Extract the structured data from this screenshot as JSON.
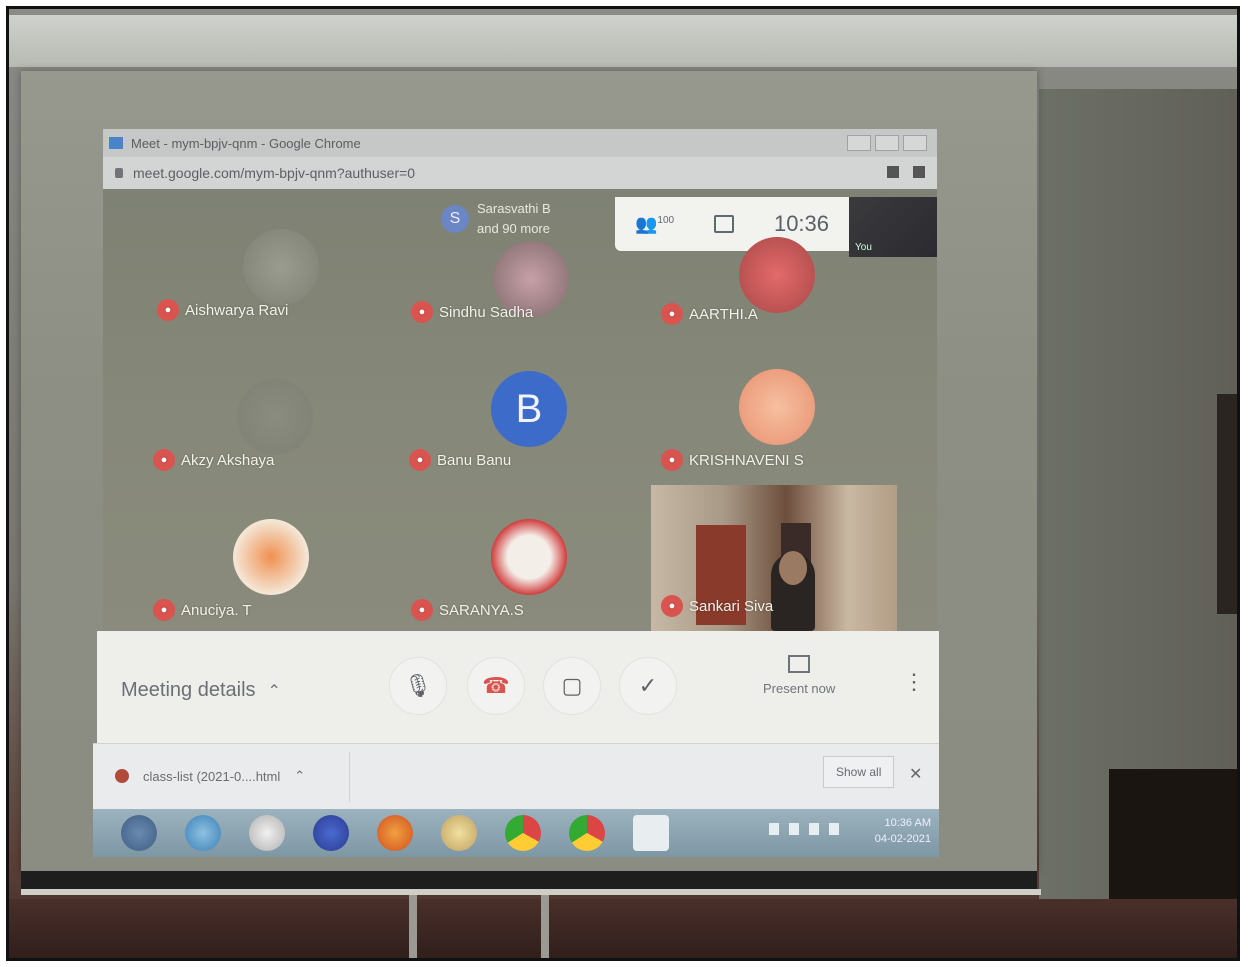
{
  "browser": {
    "title": "Meet - mym-bpjv-qnm - Google Chrome",
    "url": "meet.google.com/mym-bpjv-qnm?authuser=0"
  },
  "meet": {
    "presenter_initial": "S",
    "presenter_text_1": "Sarasvathi B",
    "presenter_text_2": "and 90 more",
    "participant_count": "100",
    "time": "10:36",
    "you_label": "You",
    "banu_initial": "B",
    "participants": [
      {
        "name": "Aishwarya Ravi"
      },
      {
        "name": "Sindhu Sadha"
      },
      {
        "name": "AARTHI.A"
      },
      {
        "name": "Akzy Akshaya"
      },
      {
        "name": "Banu Banu"
      },
      {
        "name": "KRISHNAVENI S"
      },
      {
        "name": "Anuciya. T"
      },
      {
        "name": "SARANYA.S"
      },
      {
        "name": "Sankari Siva"
      }
    ]
  },
  "controls": {
    "meeting_details": "Meeting details",
    "present_now": "Present now"
  },
  "download": {
    "file": "class-list (2021-0....html",
    "show_all": "Show all"
  },
  "taskbar": {
    "clock_time": "10:36 AM",
    "clock_date": "04-02-2021"
  },
  "colors": {
    "mute_red": "#d9534f",
    "avatar_blue": "#3d6bc9"
  }
}
